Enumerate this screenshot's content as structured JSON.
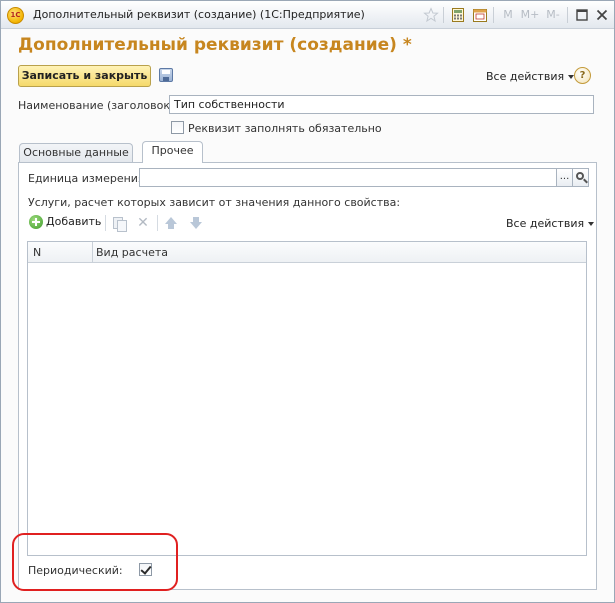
{
  "window": {
    "logo_text": "1С",
    "title": "Дополнительный реквизит (создание)  (1С:Предприятие)",
    "titlebar_buttons": [
      "M",
      "M+",
      "M-"
    ]
  },
  "form": {
    "title": "Дополнительный реквизит (создание) *",
    "save_close_label": "Записать и закрыть",
    "all_actions_label": "Все действия",
    "help_label": "?"
  },
  "fields": {
    "name_label": "Наименование (заголовок):",
    "name_value": "Тип собственности",
    "required_label": "Реквизит заполнять обязательно",
    "required_checked": false
  },
  "tabs": [
    {
      "label": "Основные данные",
      "active": false
    },
    {
      "label": "Прочее",
      "active": true
    }
  ],
  "other_tab": {
    "unit_label": "Единица измерения:",
    "unit_value": "",
    "unit_select_label": "...",
    "services_label": "Услуги, расчет которых зависит от значения данного свойства:",
    "add_label": "Добавить",
    "all_actions_label": "Все действия",
    "columns": [
      "N",
      "Вид расчета"
    ],
    "rows": [],
    "periodic_label": "Периодический:",
    "periodic_checked": true
  },
  "colors": {
    "title": "#c7861f",
    "highlight": "#e02020",
    "save_button": "#f5d96b"
  }
}
